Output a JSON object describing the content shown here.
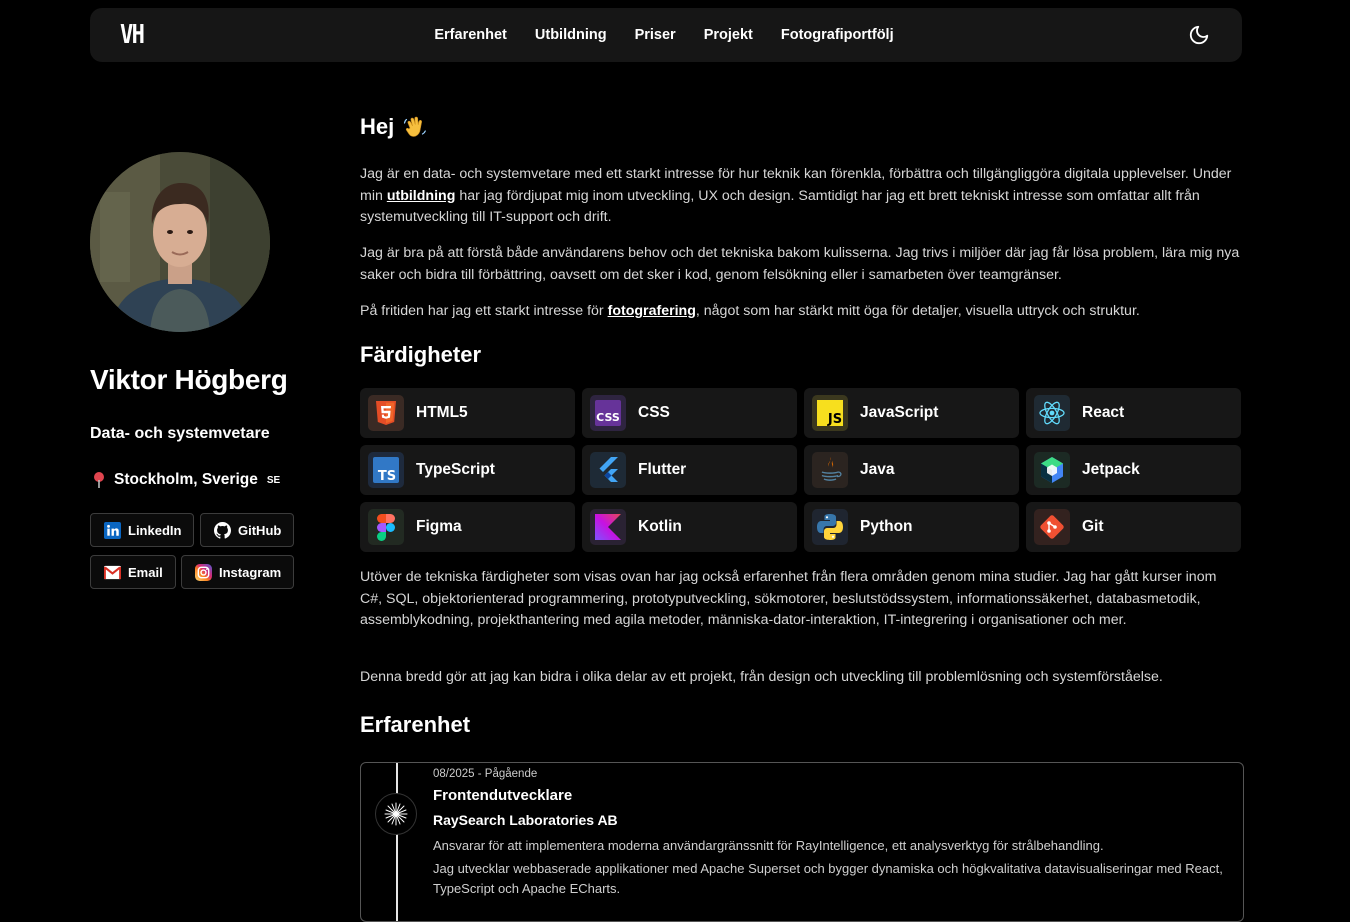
{
  "nav": {
    "logo": "VH",
    "links": [
      "Erfarenhet",
      "Utbildning",
      "Priser",
      "Projekt",
      "Fotografiportfölj"
    ],
    "theme_icon": "moon-icon"
  },
  "profile": {
    "name": "Viktor Högberg",
    "role": "Data- och systemvetare",
    "location": "Stockholm, Sverige",
    "country_code": "SE",
    "socials": [
      {
        "label": "LinkedIn",
        "icon": "linkedin-icon"
      },
      {
        "label": "GitHub",
        "icon": "github-icon"
      },
      {
        "label": "Email",
        "icon": "mail-icon"
      },
      {
        "label": "Instagram",
        "icon": "instagram-icon"
      }
    ]
  },
  "intro": {
    "heading": "Hej",
    "p1_a": "Jag är en data- och systemvetare med ett starkt intresse för hur teknik kan förenkla, förbättra och tillgängliggöra digitala upplevelser. Under min ",
    "p1_link": "utbildning",
    "p1_b": " har jag fördjupat mig inom utveckling, UX och design. Samtidigt har jag ett brett tekniskt intresse som omfattar allt från systemutveckling till IT-support och drift.",
    "p2": "Jag är bra på att förstå både användarens behov och det tekniska bakom kulisserna. Jag trivs i miljöer där jag får lösa problem, lära mig nya saker och bidra till förbättring, oavsett om det sker i kod, genom felsökning eller i samarbeten över teamgränser.",
    "p3_a": "På fritiden har jag ett starkt intresse för ",
    "p3_link": "fotografering",
    "p3_b": ", något som har stärkt mitt öga för detaljer, visuella uttryck och struktur."
  },
  "skills": {
    "heading": "Färdigheter",
    "items": [
      "HTML5",
      "CSS",
      "JavaScript",
      "React",
      "TypeScript",
      "Flutter",
      "Java",
      "Jetpack",
      "Figma",
      "Kotlin",
      "Python",
      "Git"
    ],
    "p1": "Utöver de tekniska färdigheter som visas ovan har jag också erfarenhet från flera områden genom mina studier. Jag har gått kurser inom C#, SQL, objektorienterad programmering, prototyputveckling, sökmotorer, beslutstödssystem, informationssäkerhet, databasmetodik, assemblykodning, projekthantering med agila metoder, människa-dator-interaktion, IT-integrering i organisationer och mer.",
    "p2": "Denna bredd gör att jag kan bidra i olika delar av ett projekt, från design och utveckling till problemlösning och systemförståelse."
  },
  "experience": {
    "heading": "Erfarenhet",
    "items": [
      {
        "date": "08/2025 - Pågående",
        "title": "Frontendutvecklare",
        "company": "RaySearch Laboratories AB",
        "desc1": "Ansvarar för att implementera moderna användargränssnitt för RayIntelligence, ett analysverktyg för strålbehandling.",
        "desc2": "Jag utvecklar webbaserade applikationer med Apache Superset och bygger dynamiska och högkvalitativa datavisualiseringar med React, TypeScript och Apache ECharts."
      }
    ]
  }
}
